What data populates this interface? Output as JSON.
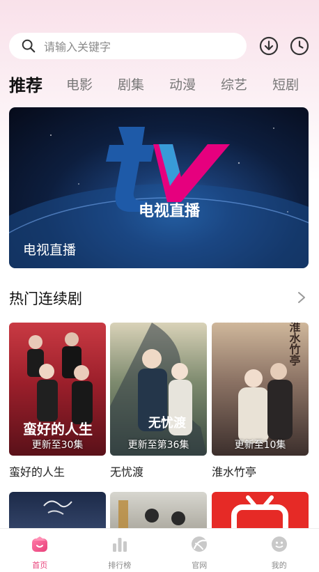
{
  "search": {
    "placeholder": "请输入关键字"
  },
  "header_icons": [
    "download-icon",
    "history-icon"
  ],
  "tabs": [
    {
      "label": "推荐",
      "active": true
    },
    {
      "label": "电影"
    },
    {
      "label": "剧集"
    },
    {
      "label": "动漫"
    },
    {
      "label": "综艺"
    },
    {
      "label": "短剧"
    }
  ],
  "banner": {
    "title": "电视直播",
    "logo_text": "tv",
    "logo_caption": "电视直播"
  },
  "section": {
    "title": "热门连续剧"
  },
  "cards": [
    {
      "name": "蛮好的人生",
      "episode": "更新至30集",
      "poster_text": "蛮好的人生"
    },
    {
      "name": "无忧渡",
      "episode": "更新至第36集",
      "poster_text": "无忧渡"
    },
    {
      "name": "淮水竹亭",
      "episode": "更新至10集",
      "poster_text": "淮水竹亭"
    }
  ],
  "nav": [
    {
      "label": "首页",
      "icon": "home-icon",
      "active": true
    },
    {
      "label": "排行榜",
      "icon": "ranking-icon"
    },
    {
      "label": "官网",
      "icon": "website-icon"
    },
    {
      "label": "我的",
      "icon": "profile-icon"
    }
  ],
  "colors": {
    "accent": "#e8417a",
    "tv_blue": "#1e5aa8",
    "tv_pink": "#e6007e"
  }
}
